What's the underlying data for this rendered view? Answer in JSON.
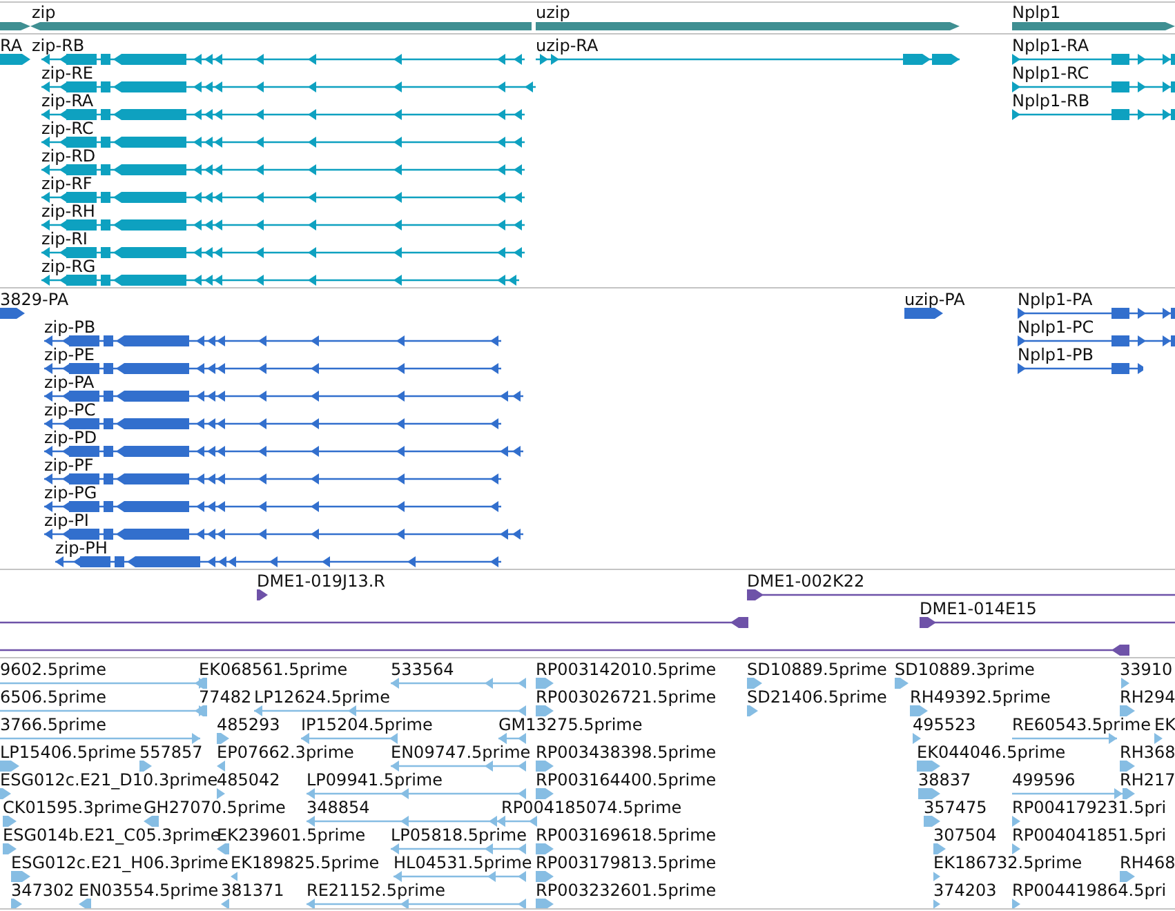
{
  "tracks": [
    {
      "kind": "gene",
      "features": [
        {
          "reverse": false
        },
        {
          "label": "zip",
          "reverse": true
        },
        {
          "label": "uzip",
          "reverse": false
        },
        {
          "label": "Nplp1",
          "reverse": false
        }
      ]
    },
    {
      "kind": "transcript",
      "features": [
        {
          "label": "RA",
          "reverse": false
        },
        {
          "label": "zip-RB",
          "reverse": true
        },
        {
          "label": "zip-RE",
          "reverse": true
        },
        {
          "label": "zip-RA",
          "reverse": true
        },
        {
          "label": "zip-RC",
          "reverse": true
        },
        {
          "label": "zip-RD",
          "reverse": true
        },
        {
          "label": "zip-RF",
          "reverse": true
        },
        {
          "label": "zip-RH",
          "reverse": true
        },
        {
          "label": "zip-RI",
          "reverse": true
        },
        {
          "label": "zip-RG",
          "reverse": true
        },
        {
          "label": "uzip-RA",
          "reverse": false
        },
        {
          "label": "Nplp1-RA",
          "reverse": false
        },
        {
          "label": "Nplp1-RC",
          "reverse": false
        },
        {
          "label": "Nplp1-RB",
          "reverse": false
        }
      ]
    },
    {
      "kind": "protein",
      "features": [
        {
          "label": "3829-PA",
          "reverse": false
        },
        {
          "label": "zip-PB",
          "reverse": true
        },
        {
          "label": "zip-PE",
          "reverse": true
        },
        {
          "label": "zip-PA",
          "reverse": true
        },
        {
          "label": "zip-PC",
          "reverse": true
        },
        {
          "label": "zip-PD",
          "reverse": true
        },
        {
          "label": "zip-PF",
          "reverse": true
        },
        {
          "label": "zip-PG",
          "reverse": true
        },
        {
          "label": "zip-PI",
          "reverse": true
        },
        {
          "label": "zip-PH",
          "reverse": true
        },
        {
          "label": "uzip-PA",
          "reverse": false
        },
        {
          "label": "Nplp1-PA",
          "reverse": false
        },
        {
          "label": "Nplp1-PC",
          "reverse": false
        },
        {
          "label": "Nplp1-PB",
          "reverse": false
        }
      ]
    },
    {
      "kind": "clone",
      "features": [
        {
          "label": "DME1-019J13.R",
          "reverse": false
        },
        {
          "label": "DME1-002K22",
          "reverse": false
        },
        {
          "reverse": true
        },
        {
          "label": "DME1-014E15",
          "reverse": false
        },
        {
          "reverse": true
        }
      ]
    },
    {
      "kind": "est",
      "features": [
        {
          "label": "9602.5prime",
          "reverse": false
        },
        {
          "label": "EK068561.5prime",
          "reverse": true
        },
        {
          "label": "533564",
          "reverse": true
        },
        {
          "label": "RP003142010.5prime",
          "reverse": false
        },
        {
          "label": "SD10889.5prime",
          "reverse": false
        },
        {
          "label": "SD10889.3prime",
          "reverse": false
        },
        {
          "label": "33910",
          "reverse": false
        },
        {
          "label": "6506.5prime",
          "reverse": false
        },
        {
          "label": "77482",
          "reverse": true
        },
        {
          "label": "LP12624.5prime",
          "reverse": true
        },
        {
          "label": "RP003026721.5prime",
          "reverse": false
        },
        {
          "label": "SD21406.5prime",
          "reverse": false
        },
        {
          "label": "RH49392.5prime",
          "reverse": false
        },
        {
          "label": "RH294",
          "reverse": false
        },
        {
          "label": "3766.5prime",
          "reverse": false
        },
        {
          "label": "485293",
          "reverse": false
        },
        {
          "label": "IP15204.5prime",
          "reverse": true
        },
        {
          "label": "GM13275.5prime",
          "reverse": true
        },
        {
          "label": "495523",
          "reverse": false
        },
        {
          "label": "RE60543.5prime",
          "reverse": false
        },
        {
          "label": "EK",
          "reverse": false
        },
        {
          "label": "LP15406.5prime",
          "reverse": false
        },
        {
          "label": "557857",
          "reverse": false
        },
        {
          "label": "EP07662.3prime",
          "reverse": true
        },
        {
          "label": "EN09747.5prime",
          "reverse": true
        },
        {
          "label": "RP003438398.5prime",
          "reverse": false
        },
        {
          "label": "EK044046.5prime",
          "reverse": false
        },
        {
          "label": "RH368",
          "reverse": false
        },
        {
          "label": "ESG012c.E21_D10.3prime",
          "reverse": false
        },
        {
          "label": "485042",
          "reverse": false
        },
        {
          "label": "LP09941.5prime",
          "reverse": true
        },
        {
          "label": "RP003164400.5prime",
          "reverse": false
        },
        {
          "label": "38837",
          "reverse": false
        },
        {
          "label": "499596",
          "reverse": false
        },
        {
          "label": "RH217",
          "reverse": false
        },
        {
          "label": "CK01595.3prime",
          "reverse": false
        },
        {
          "label": "GH27070.5prime",
          "reverse": true
        },
        {
          "label": "348854",
          "reverse": true
        },
        {
          "label": "RP004185074.5prime",
          "reverse": true
        },
        {
          "label": "357475",
          "reverse": false
        },
        {
          "label": "RP004179231.5pri",
          "reverse": false
        },
        {
          "label": "ESG014b.E21_C05.3prime",
          "reverse": false
        },
        {
          "label": "EK239601.5prime",
          "reverse": true
        },
        {
          "label": "LP05818.5prime",
          "reverse": true
        },
        {
          "label": "RP003169618.5prime",
          "reverse": false
        },
        {
          "label": "307504",
          "reverse": false
        },
        {
          "label": "RP004041851.5pri",
          "reverse": false
        },
        {
          "label": "ESG012c.E21_H06.3prime",
          "reverse": false
        },
        {
          "label": "EK189825.5prime",
          "reverse": true
        },
        {
          "label": "HL04531.5prime",
          "reverse": true
        },
        {
          "label": "RP003179813.5prime",
          "reverse": false
        },
        {
          "label": "EK186732.5prime",
          "reverse": false
        },
        {
          "label": "RH468",
          "reverse": false
        },
        {
          "label": "347302",
          "reverse": false
        },
        {
          "label": "EN03554.5prime",
          "reverse": true
        },
        {
          "label": "381371",
          "reverse": true
        },
        {
          "label": "RE21152.5prime",
          "reverse": true
        },
        {
          "label": "RP003232601.5prime",
          "reverse": false
        },
        {
          "label": "374203",
          "reverse": false
        },
        {
          "label": "RP004419864.5pri",
          "reverse": false
        }
      ]
    }
  ]
}
